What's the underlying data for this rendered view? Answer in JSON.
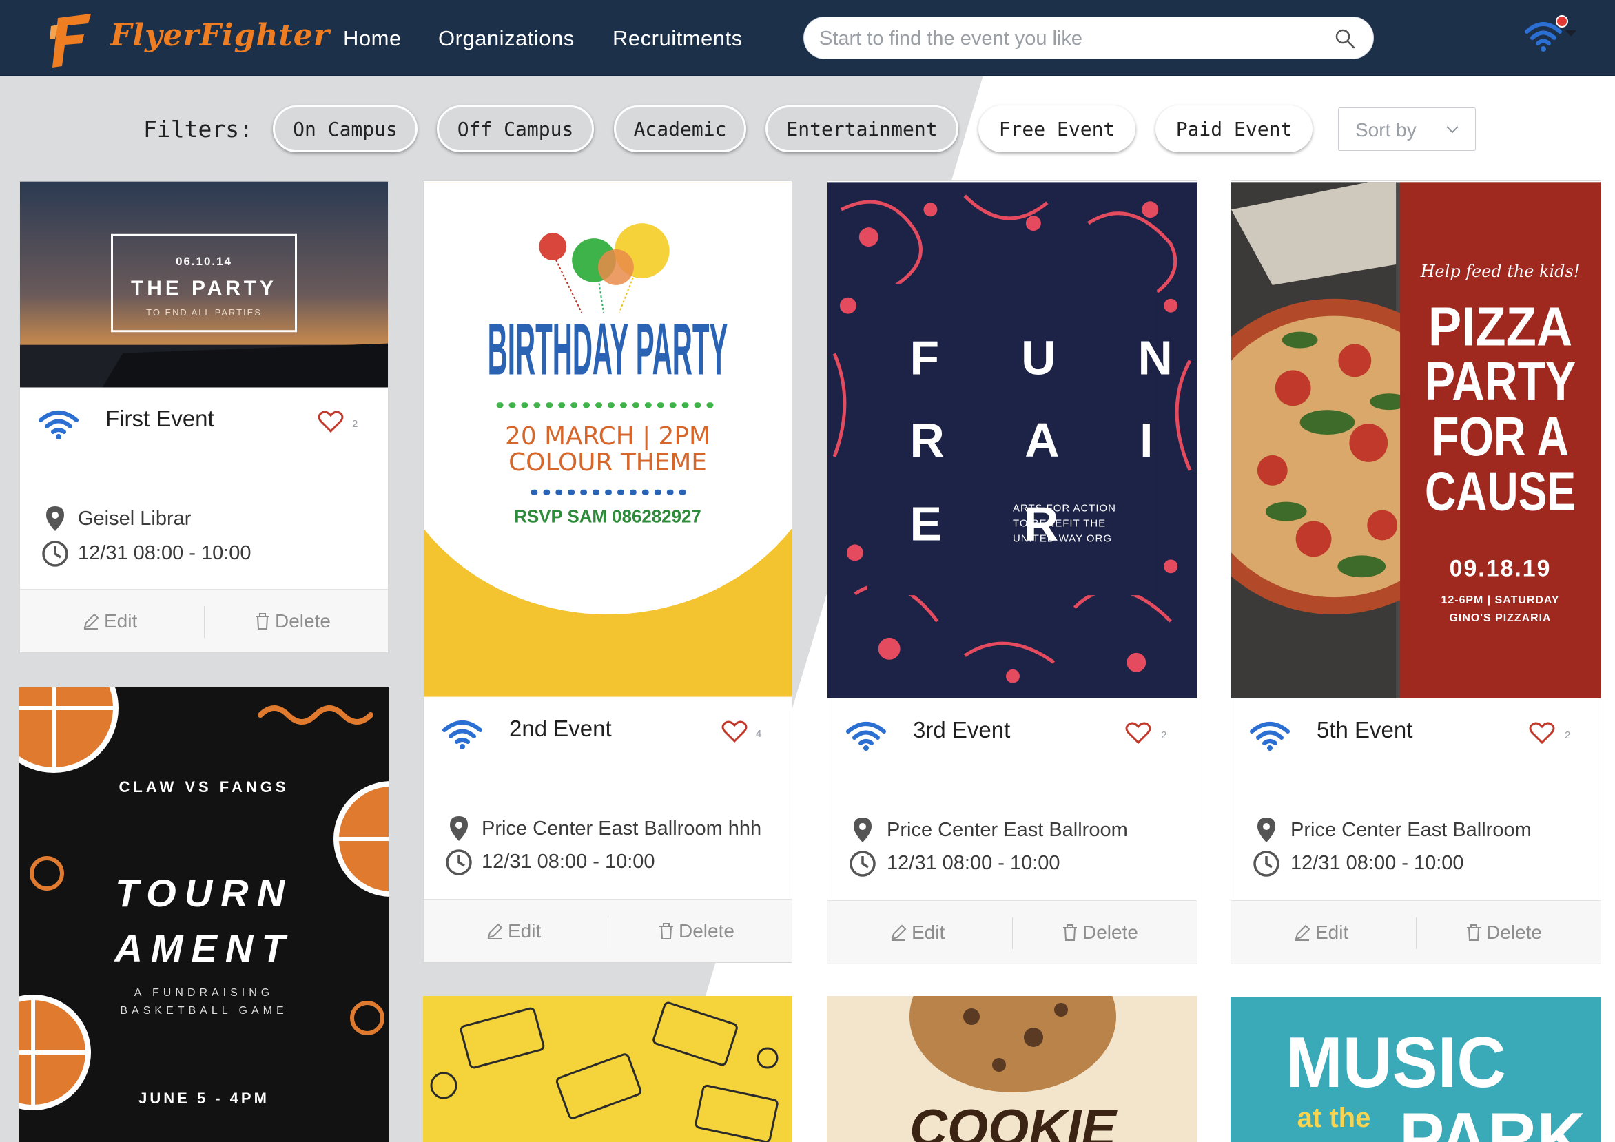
{
  "app": {
    "logo_text": "FlyerFighter",
    "nav": [
      "Home",
      "Organizations",
      "Recruitments"
    ],
    "search_placeholder": "Start to find the event you like"
  },
  "filters": {
    "label": "Filters:",
    "pills": [
      "On Campus",
      "Off Campus",
      "Academic",
      "Entertainment",
      "Free Event",
      "Paid Event"
    ],
    "sort_placeholder": "Sort by"
  },
  "cards": [
    {
      "title": "First Event",
      "likes": "2",
      "location": "Geisel Librar",
      "time": "12/31 08:00 - 10:00",
      "edit": "Edit",
      "delete": "Delete",
      "flyer": {
        "date": "06.10.14",
        "headline": "THE PARTY",
        "sub": "TO END ALL PARTIES"
      }
    },
    {
      "title": "2nd Event",
      "likes": "4",
      "location": "Price Center East Ballroom hhh",
      "time": "12/31 08:00 - 10:00",
      "edit": "Edit",
      "delete": "Delete",
      "flyer": {
        "headline": "BIRTHDAY PARTY",
        "line1": "20 MARCH | 2PM",
        "line2": "COLOUR THEME",
        "rsvp": "RSVP SAM 086282927"
      }
    },
    {
      "title": "3rd Event",
      "likes": "2",
      "location": "Price Center East Ballroom",
      "time": "12/31 08:00 - 10:00",
      "edit": "Edit",
      "delete": "Delete",
      "flyer": {
        "row1": "F U N D",
        "row2": "R A I S",
        "row3": "E R",
        "note1": "ARTS FOR ACTION",
        "note2": "TO BENEFIT THE",
        "note3": "UNITED WAY ORG"
      }
    },
    {
      "title": "5th Event",
      "likes": "2",
      "location": "Price Center East Ballroom",
      "time": "12/31 08:00 - 10:00",
      "edit": "Edit",
      "delete": "Delete",
      "flyer": {
        "script": "Help feed the kids!",
        "l1": "PIZZA",
        "l2": "PARTY",
        "l3": "FOR A",
        "l4": "CAUSE",
        "date": "09.18.19",
        "info1": "12-6PM | SATURDAY",
        "info2": "GINO'S PIZZARIA"
      }
    }
  ],
  "partial_cards": {
    "tournament": {
      "top": "CLAW VS FANGS",
      "l1": "TOURN",
      "l2": "AMENT",
      "sub1": "A FUNDRAISING",
      "sub2": "BASKETBALL GAME",
      "date": "JUNE 5 - 4PM"
    },
    "music": {
      "l1": "MUSIC",
      "l2": "at the",
      "l3": "PARK"
    },
    "cookie": {
      "text": "COOKIE"
    }
  },
  "colors": {
    "topbar": "#1d3049",
    "accent": "#ef7d22",
    "wifi": "#2a6fd1",
    "heart": "#c0392b",
    "notif": "#e53935"
  }
}
